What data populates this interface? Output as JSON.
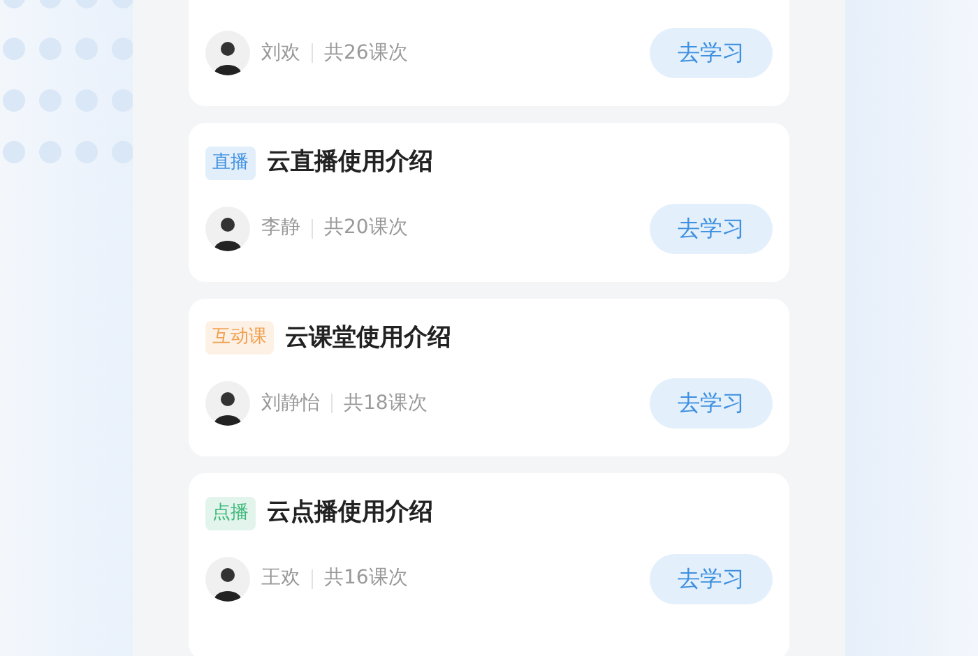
{
  "courses": [
    {
      "teacher": "刘欢",
      "lessons": "共26课次",
      "button": "去学习"
    },
    {
      "tag": {
        "label": "直播",
        "color": "#3d8fe0"
      },
      "title": "云直播使用介绍",
      "teacher": "李静",
      "lessons": "共20课次",
      "button": "去学习"
    },
    {
      "tag": {
        "label": "互动课",
        "color": "#f0a050"
      },
      "title": "云课堂使用介绍",
      "teacher": "刘静怡",
      "lessons": "共18课次",
      "button": "去学习"
    },
    {
      "tag": {
        "label": "点播",
        "color": "#3cb87a"
      },
      "title": "云点播使用介绍",
      "teacher": "王欢",
      "lessons": "共16课次",
      "button": "去学习"
    }
  ]
}
